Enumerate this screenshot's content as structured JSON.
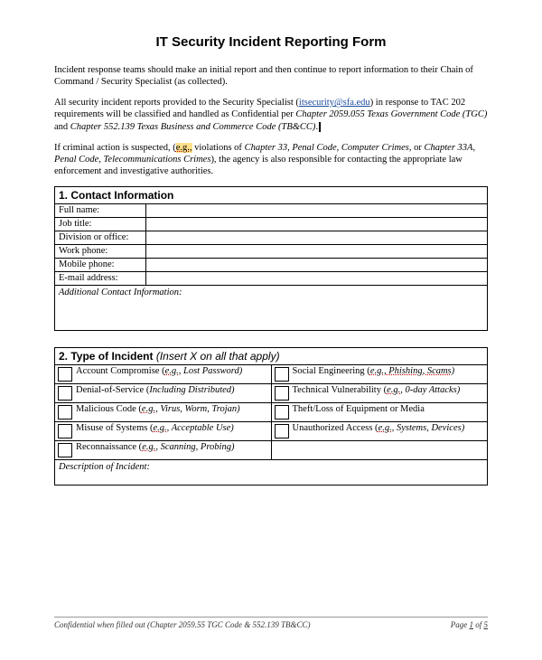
{
  "title": "IT Security Incident Reporting Form",
  "para1": "Incident response teams should make an initial report and then continue to report information to their Chain of Command / Security Specialist (as collected).",
  "para2_a": "All security incident reports provided to the Security Specialist (",
  "para2_link": "itsecurity@sfa.edu",
  "para2_b": ") in response to TAC 202 requirements will be classified and handled as Confidential per ",
  "para2_c": "Chapter 2059.055 Texas Government Code (TGC)",
  "para2_d": " and ",
  "para2_e": "Chapter 552.139 Texas Business and Commerce Code (TB&CC)",
  "para2_f": ".",
  "para3_a": "If criminal action is suspected, (",
  "para3_eg": "e.g.,",
  "para3_b": " violations of ",
  "para3_c": "Chapter 33, Penal Code, Computer Crimes",
  "para3_d": ", or ",
  "para3_e": "Chapter 33A, Penal Code, Telecommunications Crimes",
  "para3_f": "), the agency is also responsible for contacting the appropriate law enforcement and investigative authorities.",
  "section1": {
    "num": "1.",
    "title": "Contact Information"
  },
  "fields": [
    {
      "label": "Full name:"
    },
    {
      "label": "Job title:"
    },
    {
      "label": "Division or office:"
    },
    {
      "label": "Work phone:"
    },
    {
      "label": "Mobile phone:"
    },
    {
      "label": "E-mail address:"
    }
  ],
  "additional": "Additional Contact Information:",
  "section2": {
    "num": "2.",
    "title": "Type of Incident",
    "hint": "(Insert X on all that apply)"
  },
  "eg": "e.g.,",
  "left_items": [
    {
      "pre": "Account Compromise (",
      "eg": true,
      "post": " Lost Password",
      "close": ")"
    },
    {
      "pre": "Denial-of-Service (",
      "post": "Including Distributed",
      "close": ")",
      "plainParen": true
    },
    {
      "pre": "Malicious Code (",
      "eg": true,
      "post": " Virus, Worm, Trojan",
      "close": ")"
    },
    {
      "pre": "Misuse of Systems (",
      "eg": true,
      "post": " Acceptable Use",
      "close": ")"
    },
    {
      "pre": "Reconnaissance (",
      "eg": true,
      "post": " Scanning, Probing",
      "close": ")"
    }
  ],
  "right_items": [
    {
      "pre": "Social Engineering (",
      "eg": true,
      "post": " Phishing, Scams",
      "close": ")",
      "udPost": true
    },
    {
      "pre": "Technical Vulnerability (",
      "eg": true,
      "post": " 0-day Attacks",
      "close": ")"
    },
    {
      "pre": "Theft/Loss of Equipment or Media",
      "close": ""
    },
    {
      "pre": "Unauthorized Access (",
      "eg": true,
      "post": " Systems, Devices",
      "close": ")"
    }
  ],
  "desc": "Description of Incident:",
  "footer_left": "Confidential when filled out (Chapter 2059.55 TGC Code & 552.139 TB&CC)",
  "footer_right_a": "Page ",
  "footer_right_b": "1",
  "footer_right_c": " of ",
  "footer_right_d": "5"
}
